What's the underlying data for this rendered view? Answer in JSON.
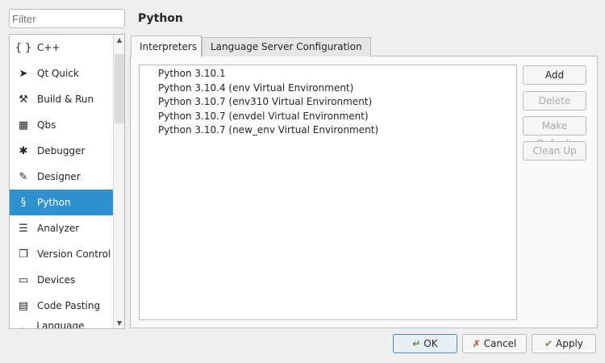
{
  "filter": {
    "placeholder": "Filter"
  },
  "title": "Python",
  "categories": [
    {
      "label": "C++",
      "icon": "braces-icon"
    },
    {
      "label": "Qt Quick",
      "icon": "paper-plane-icon"
    },
    {
      "label": "Build & Run",
      "icon": "hammer-icon"
    },
    {
      "label": "Qbs",
      "icon": "grid-icon"
    },
    {
      "label": "Debugger",
      "icon": "bug-icon"
    },
    {
      "label": "Designer",
      "icon": "pen-icon"
    },
    {
      "label": "Python",
      "icon": "python-icon",
      "selected": true
    },
    {
      "label": "Analyzer",
      "icon": "analyzer-icon"
    },
    {
      "label": "Version Control",
      "icon": "documents-icon"
    },
    {
      "label": "Devices",
      "icon": "devices-icon"
    },
    {
      "label": "Code Pasting",
      "icon": "clipboard-icon"
    },
    {
      "label": "Language Client",
      "icon": "language-client-icon"
    }
  ],
  "tabs": [
    "Interpreters",
    "Language Server Configuration"
  ],
  "interpreters": [
    "Python 3.10.1",
    "Python 3.10.4 (env Virtual Environment)",
    "Python 3.10.7 (env310 Virtual Environment)",
    "Python 3.10.7 (envdel Virtual Environment)",
    "Python 3.10.7 (new_env Virtual Environment)"
  ],
  "side_buttons": {
    "add": "Add",
    "delete": "Delete",
    "make_default": "Make Default",
    "clean_up": "Clean Up"
  },
  "footer": {
    "ok": "OK",
    "cancel": "Cancel",
    "apply": "Apply"
  },
  "colors": {
    "selection": "#3091d0",
    "ok_icon": "#5a8a3a",
    "cancel_icon": "#c0392b",
    "apply_icon": "#5a9a3a"
  }
}
